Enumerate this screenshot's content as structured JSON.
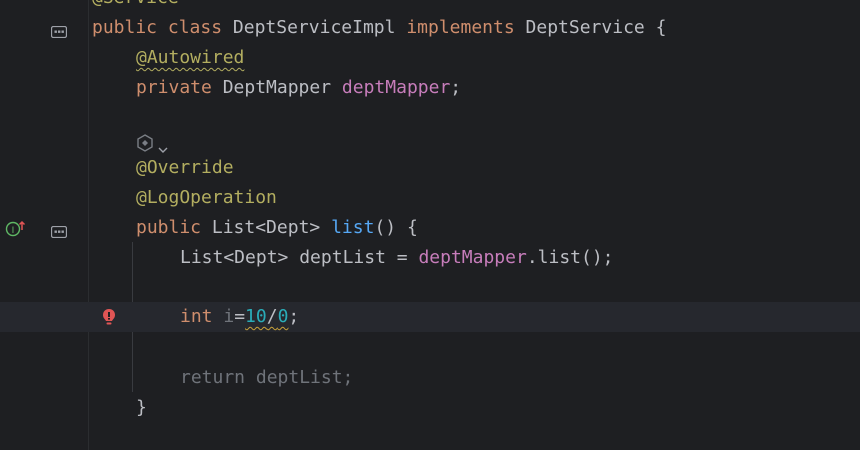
{
  "code": {
    "line0": {
      "ann": "@Service"
    },
    "line1": {
      "kw1": "public",
      "kw2": "class",
      "cls": "DeptServiceImpl",
      "kw3": "implements",
      "iface": "DeptService",
      "brace": "{"
    },
    "line2": {
      "ann": "@Autowired"
    },
    "line3": {
      "kw": "private",
      "type": "DeptMapper",
      "field": "deptMapper",
      "semi": ";"
    },
    "line5": {
      "ann": "@Override"
    },
    "line6": {
      "ann": "@LogOperation"
    },
    "line7": {
      "kw": "public",
      "type": "List<Dept>",
      "method": "list",
      "rest": "() {"
    },
    "line8": {
      "type": "List<Dept>",
      "var": "deptList",
      "eq": "=",
      "field": "deptMapper",
      "rest": ".list();"
    },
    "line10": {
      "kw": "int",
      "var": "i",
      "eq": "=",
      "num1": "10",
      "slash": "/",
      "num2": "0",
      "semi": ";"
    },
    "line12": {
      "text": "return deptList;"
    },
    "line13": {
      "brace": "}"
    }
  },
  "gutter": {
    "icons": [
      "implementation-icon",
      "override-up-icon",
      "ai-assistant-icon",
      "error-bulb-icon"
    ]
  },
  "colors": {
    "background": "#1e1f22",
    "current_line": "#26282e",
    "keyword": "#cf8e6d",
    "annotation": "#b3ae60",
    "field": "#c77dbb",
    "method": "#56a8f5",
    "number": "#2aacb8",
    "error": "#e05555"
  }
}
